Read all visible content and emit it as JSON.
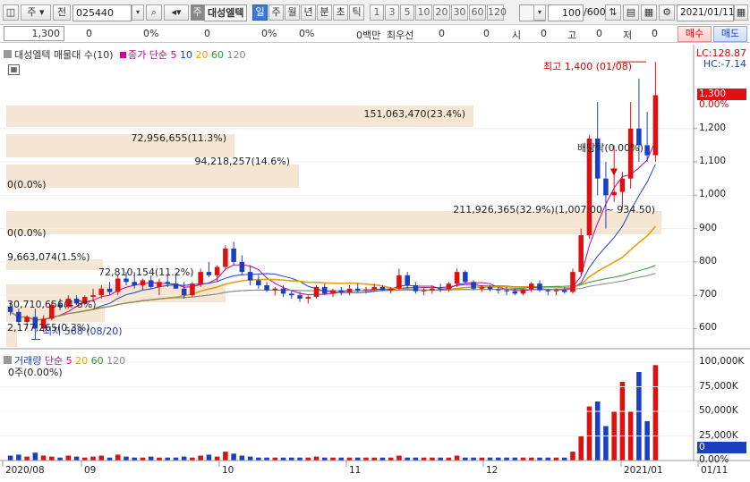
{
  "toolbar": {
    "type_label": "주",
    "prev_label": "전",
    "code": "025440",
    "stock_badge": "주",
    "stock_name": "대성엘텍",
    "periods": [
      "일",
      "주",
      "월",
      "년",
      "분",
      "초",
      "틱"
    ],
    "active_period": "일",
    "nums": [
      "1",
      "3",
      "5",
      "10",
      "20",
      "30",
      "60",
      "120"
    ],
    "count": "100",
    "count_total": "/600",
    "date": "2021/01/11",
    "icons": [
      "window-icon",
      "search-icon",
      "speaker-icon",
      "settings-icon",
      "save-icon",
      "grid-icon",
      "gear-icon",
      "calendar-icon"
    ]
  },
  "quote": {
    "price": "1,300",
    "change": "0",
    "change_pct": "0%",
    "v1": "0",
    "v1_pct": "0%",
    "v2_pct": "0%",
    "volume_unit": "0백만",
    "best_ask_label": "최우선",
    "ask_vals": [
      "0",
      "0"
    ],
    "ohlc_labels": [
      "시",
      "고",
      "저"
    ],
    "ohlc_vals": [
      "0",
      "0",
      "0"
    ],
    "buy_label": "매수",
    "sell_label": "매도"
  },
  "price_panel": {
    "legend_title": "대성엘텍 매물대 수(10)",
    "legend_ma": "종가 단순",
    "ma_periods": [
      "5",
      "10",
      "20",
      "60",
      "120"
    ],
    "ma_colors": [
      "#cc0099",
      "#1a3fcc",
      "#e8a000",
      "#2e9a2e",
      "#888888"
    ],
    "lc": "LC:128.87",
    "hc": "HC:-7.14",
    "current_price": "1,300",
    "current_pct": "0.00%",
    "high_marker": "최고 1,400 (01/08)",
    "low_marker": "최저 568 (08/20)",
    "dividend_marker": "배당락(0.00%)",
    "yaxis": [
      "1,200",
      "1,100",
      "1,000",
      "900",
      "800",
      "700",
      "600"
    ],
    "volume_profile": [
      {
        "label": "151,063,470(23.4%)"
      },
      {
        "label": "72,956,655(11.3%)"
      },
      {
        "label": "94,218,257(14.6%)"
      },
      {
        "label": "0(0.0%)"
      },
      {
        "label": "211,926,365(32.9%)(1,007.00 ~ 934.50)"
      },
      {
        "label": "0(0.0%)"
      },
      {
        "label": "9,663,074(1.5%)"
      },
      {
        "label": "72,810,154(11.2%)"
      },
      {
        "label": "30,710,656(4.8%)"
      },
      {
        "label": "2,177,265(0.3%)"
      }
    ]
  },
  "volume_panel": {
    "legend_title": "거래량",
    "legend_ma": "단순",
    "ma_periods": [
      "5",
      "20",
      "60",
      "120"
    ],
    "info": "0주(0.00%)",
    "yaxis": [
      "100,000K",
      "75,000K",
      "50,000K",
      "25,000K",
      "0.00%"
    ],
    "current": "0"
  },
  "xaxis": [
    "2020/08",
    "09",
    "10",
    "11",
    "12",
    "2021/01",
    "01/11"
  ],
  "chart_data": {
    "type": "candlestick",
    "title": "대성엘텍",
    "ylim": [
      545,
      1430
    ],
    "candles": [
      [
        665,
        680,
        640,
        650
      ],
      [
        650,
        660,
        610,
        620
      ],
      [
        620,
        640,
        600,
        635
      ],
      [
        635,
        660,
        568,
        600
      ],
      [
        600,
        640,
        590,
        630
      ],
      [
        630,
        680,
        625,
        672
      ],
      [
        672,
        690,
        655,
        665
      ],
      [
        665,
        700,
        660,
        690
      ],
      [
        690,
        700,
        670,
        675
      ],
      [
        675,
        700,
        670,
        695
      ],
      [
        695,
        720,
        680,
        700
      ],
      [
        700,
        730,
        690,
        720
      ],
      [
        720,
        740,
        700,
        710
      ],
      [
        710,
        760,
        700,
        750
      ],
      [
        750,
        770,
        730,
        740
      ],
      [
        740,
        770,
        720,
        730
      ],
      [
        730,
        750,
        715,
        745
      ],
      [
        745,
        760,
        720,
        725
      ],
      [
        725,
        750,
        700,
        740
      ],
      [
        740,
        760,
        725,
        735
      ],
      [
        735,
        760,
        720,
        720
      ],
      [
        720,
        740,
        690,
        700
      ],
      [
        700,
        740,
        695,
        735
      ],
      [
        735,
        780,
        725,
        770
      ],
      [
        770,
        800,
        755,
        760
      ],
      [
        760,
        790,
        740,
        785
      ],
      [
        785,
        850,
        775,
        840
      ],
      [
        840,
        860,
        790,
        800
      ],
      [
        800,
        820,
        760,
        770
      ],
      [
        770,
        790,
        730,
        745
      ],
      [
        745,
        760,
        720,
        730
      ],
      [
        730,
        740,
        710,
        715
      ],
      [
        715,
        725,
        700,
        720
      ],
      [
        720,
        730,
        695,
        705
      ],
      [
        705,
        715,
        690,
        700
      ],
      [
        700,
        710,
        680,
        690
      ],
      [
        690,
        700,
        675,
        695
      ],
      [
        695,
        730,
        690,
        725
      ],
      [
        725,
        735,
        700,
        705
      ],
      [
        705,
        720,
        695,
        715
      ],
      [
        715,
        725,
        700,
        710
      ],
      [
        710,
        730,
        700,
        720
      ],
      [
        720,
        735,
        710,
        715
      ],
      [
        715,
        725,
        705,
        718
      ],
      [
        718,
        735,
        710,
        725
      ],
      [
        725,
        730,
        712,
        715
      ],
      [
        715,
        725,
        705,
        720
      ],
      [
        720,
        780,
        715,
        760
      ],
      [
        760,
        770,
        720,
        730
      ],
      [
        730,
        740,
        705,
        712
      ],
      [
        712,
        725,
        700,
        715
      ],
      [
        715,
        730,
        705,
        720
      ],
      [
        720,
        735,
        710,
        718
      ],
      [
        718,
        740,
        710,
        735
      ],
      [
        735,
        780,
        725,
        770
      ],
      [
        770,
        775,
        735,
        740
      ],
      [
        740,
        745,
        715,
        720
      ],
      [
        720,
        730,
        710,
        725
      ],
      [
        725,
        730,
        712,
        718
      ],
      [
        718,
        725,
        705,
        715
      ],
      [
        715,
        725,
        700,
        712
      ],
      [
        712,
        720,
        700,
        705
      ],
      [
        705,
        720,
        700,
        718
      ],
      [
        718,
        740,
        710,
        735
      ],
      [
        735,
        745,
        710,
        715
      ],
      [
        715,
        720,
        700,
        712
      ],
      [
        712,
        720,
        700,
        715
      ],
      [
        715,
        725,
        705,
        710
      ],
      [
        710,
        780,
        705,
        770
      ],
      [
        770,
        900,
        760,
        880
      ],
      [
        880,
        1180,
        870,
        1170
      ],
      [
        1170,
        1280,
        1000,
        1050
      ],
      [
        1050,
        1100,
        900,
        1000
      ],
      [
        1000,
        1150,
        980,
        1010
      ],
      [
        1010,
        1070,
        960,
        1050
      ],
      [
        1050,
        1280,
        1020,
        1200
      ],
      [
        1200,
        1350,
        1100,
        1150
      ],
      [
        1150,
        1250,
        1100,
        1120
      ],
      [
        1120,
        1400,
        1100,
        1300
      ]
    ],
    "volume": [
      5,
      6,
      4,
      8,
      5,
      4,
      3,
      5,
      4,
      3,
      4,
      5,
      3,
      6,
      4,
      3,
      3,
      4,
      3,
      3,
      3,
      4,
      3,
      5,
      6,
      4,
      9,
      7,
      5,
      4,
      3,
      3,
      3,
      3,
      3,
      3,
      3,
      4,
      3,
      3,
      3,
      3,
      3,
      3,
      3,
      3,
      3,
      5,
      3,
      3,
      3,
      3,
      3,
      3,
      5,
      3,
      3,
      3,
      3,
      3,
      3,
      3,
      3,
      3,
      3,
      3,
      3,
      3,
      9,
      25,
      55,
      60,
      35,
      50,
      80,
      50,
      90,
      40,
      97
    ],
    "volume_unit": "K (thousands of shares)"
  }
}
